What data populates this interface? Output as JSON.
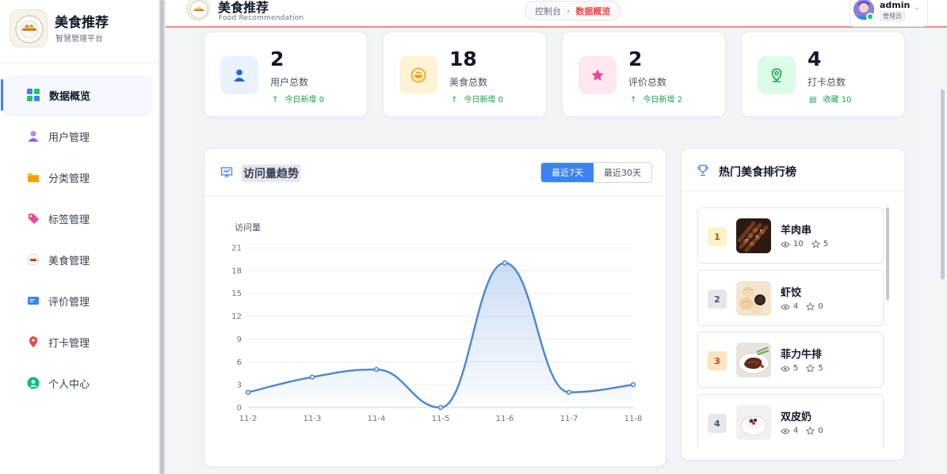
{
  "brand": {
    "title": "美食推荐",
    "subtitle": "智慧管理平台"
  },
  "sidebar": {
    "items": [
      {
        "label": "数据概览",
        "icon": "dashboard-grid-icon",
        "active": true
      },
      {
        "label": "用户管理",
        "icon": "user-icon"
      },
      {
        "label": "分类管理",
        "icon": "folder-icon"
      },
      {
        "label": "标签管理",
        "icon": "tag-icon"
      },
      {
        "label": "美食管理",
        "icon": "food-icon"
      },
      {
        "label": "评价管理",
        "icon": "comment-icon"
      },
      {
        "label": "打卡管理",
        "icon": "location-pin-icon"
      },
      {
        "label": "个人中心",
        "icon": "profile-icon"
      }
    ]
  },
  "header": {
    "title": "美食推荐",
    "subtitle": "Food Recommendation",
    "breadcrumb": {
      "parent": "控制台",
      "separator": "›",
      "current": "数据概览"
    },
    "user": {
      "name": "admin",
      "role": "管理员",
      "caret": "⌄"
    }
  },
  "stats": [
    {
      "value": "2",
      "label": "用户总数",
      "sub": "今日新增 0",
      "sub_icon": "↑",
      "icon": "user-icon",
      "color": "#2563eb",
      "bg": "#eaf1ff"
    },
    {
      "value": "18",
      "label": "美食总数",
      "sub": "今日新增 0",
      "sub_icon": "↑",
      "icon": "food-bowl-icon",
      "color": "#f59e0b",
      "bg": "#fff3d6"
    },
    {
      "value": "2",
      "label": "评价总数",
      "sub": "今日新增 2",
      "sub_icon": "↑",
      "icon": "star-icon",
      "color": "#ec4899",
      "bg": "#fde7f1"
    },
    {
      "value": "4",
      "label": "打卡总数",
      "sub": "收藏 10",
      "sub_icon": "▤",
      "icon": "location-pin-icon",
      "color": "#16a34a",
      "bg": "#dcfce7"
    }
  ],
  "trend": {
    "title": "访问量趋势",
    "range_options": [
      "最近7天",
      "最近30天"
    ],
    "selected_range": "最近7天"
  },
  "chart_data": {
    "type": "line",
    "title": "访问量趋势",
    "ylabel": "访问量",
    "xlabel": "",
    "categories": [
      "11-2",
      "11-3",
      "11-4",
      "11-5",
      "11-6",
      "11-7",
      "11-8"
    ],
    "values": [
      2,
      4,
      5,
      0,
      19,
      2,
      3
    ],
    "ylim": [
      0,
      21
    ],
    "yticks": [
      0,
      3,
      6,
      9,
      12,
      15,
      18,
      21
    ],
    "grid": true,
    "smooth": true,
    "area": true,
    "color": "#4a86d8"
  },
  "ranking": {
    "title": "热门美食排行榜",
    "items": [
      {
        "rank": "1",
        "name": "羊肉串",
        "views": "10",
        "stars": "5",
        "badge_bg": "#fef3c7",
        "badge_fg": "#b45309"
      },
      {
        "rank": "2",
        "name": "虾饺",
        "views": "4",
        "stars": "0",
        "badge_bg": "#e5e7eb",
        "badge_fg": "#4b5563"
      },
      {
        "rank": "3",
        "name": "菲力牛排",
        "views": "5",
        "stars": "5",
        "badge_bg": "#fde2c4",
        "badge_fg": "#c2410c"
      },
      {
        "rank": "4",
        "name": "双皮奶",
        "views": "4",
        "stars": "0",
        "badge_bg": "#e5e7eb",
        "badge_fg": "#4b5563"
      }
    ]
  }
}
